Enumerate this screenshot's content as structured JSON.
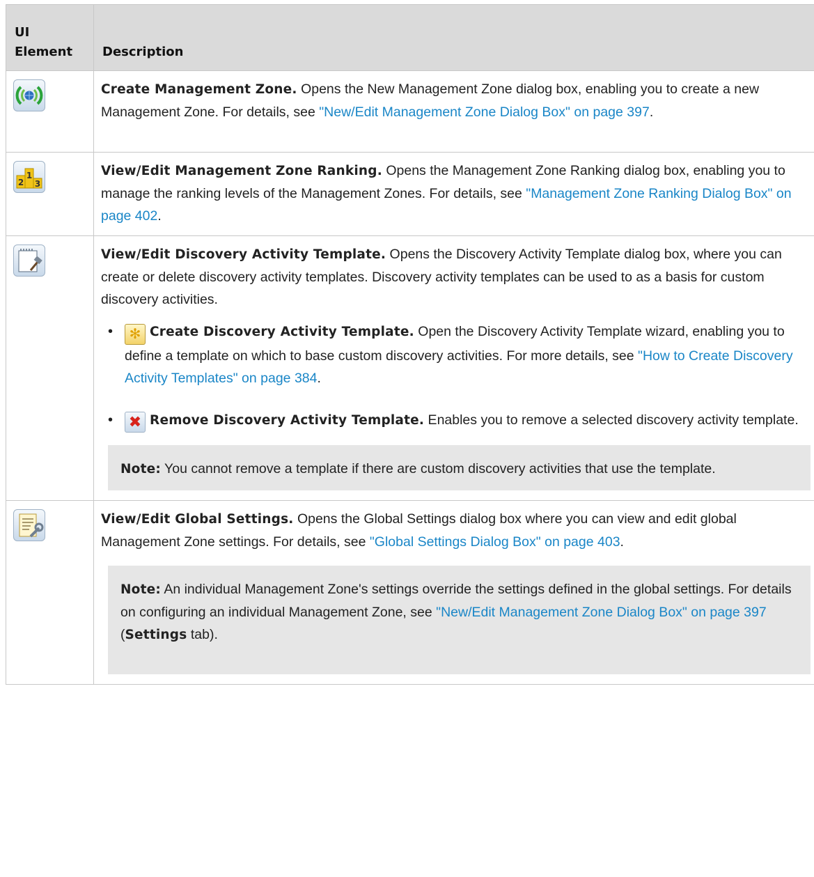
{
  "table": {
    "header": {
      "col1": "UI Element",
      "col2": "Description"
    },
    "rows": [
      {
        "icon": "management-zone-icon",
        "title": "Create Management Zone.",
        "text": " Opens the New Management Zone dialog box, enabling you to create a new Management Zone. For details, see ",
        "link": "\"New/Edit Management Zone Dialog Box\" on page 397",
        "after": "."
      },
      {
        "icon": "ranking-icon",
        "title": "View/Edit Management Zone Ranking.",
        "text": " Opens the Management Zone Ranking dialog box, enabling you to manage the ranking levels of the Management Zones. For details, see ",
        "link": "\"Management Zone Ranking Dialog Box\" on page 402",
        "after": "."
      },
      {
        "icon": "template-edit-icon",
        "title": "View/Edit Discovery Activity Template.",
        "text": " Opens the Discovery Activity Template dialog box, where you can create or delete discovery activity templates. Discovery activity templates can be used to as a basis for custom discovery activities.",
        "subitems": [
          {
            "icon": "create-star-icon",
            "title": "Create Discovery Activity Template.",
            "text": " Open the Discovery Activity Template wizard, enabling you to define a template on which to base custom discovery activities. For more details, see ",
            "link": "\"How to Create Discovery Activity Templates\" on page 384",
            "after": "."
          },
          {
            "icon": "remove-x-icon",
            "title": "Remove Discovery Activity Template.",
            "text": " Enables you to remove a selected discovery activity template."
          }
        ],
        "note": {
          "label": "Note:",
          "text": " You cannot remove a template if there are custom discovery activities that use the template."
        }
      },
      {
        "icon": "global-settings-icon",
        "title": "View/Edit Global Settings.",
        "text": " Opens the Global Settings dialog box where you can view and edit global Management Zone settings. For details, see ",
        "link": "\"Global Settings Dialog Box\" on page 403",
        "after": ".",
        "note": {
          "label": "Note:",
          "text": " An individual Management Zone's settings override the settings defined in the global settings. For details on configuring an individual Management Zone, see ",
          "link": "\"New/Edit Management Zone Dialog Box\" on page 397",
          "mid": " (",
          "bold": "Settings",
          "after": " tab)."
        }
      }
    ]
  }
}
